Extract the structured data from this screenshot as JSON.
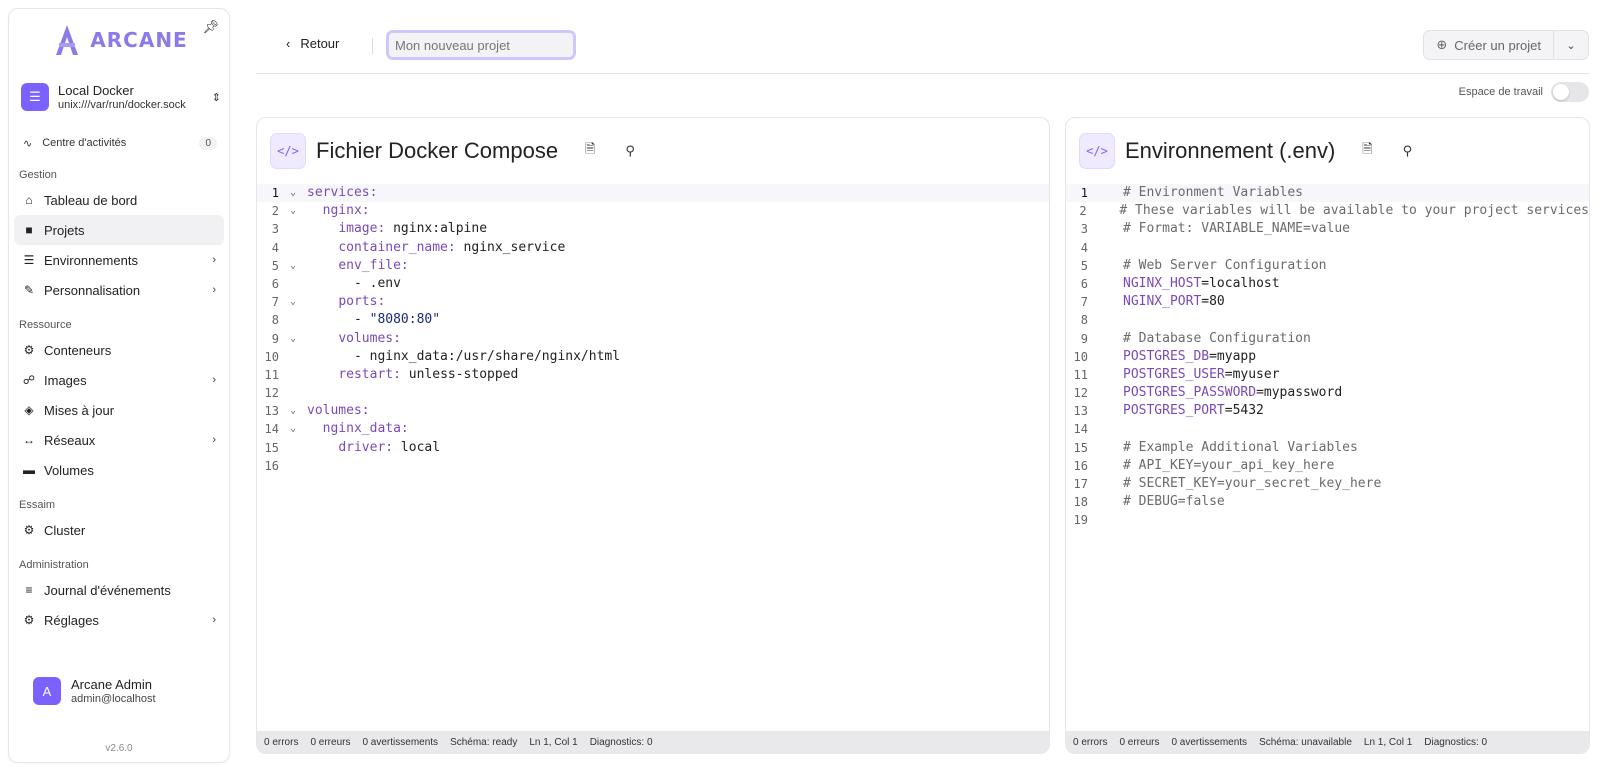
{
  "sidebar": {
    "logo_text": "ARCANE",
    "env_name": "Local Docker",
    "env_socket": "unix:///var/run/docker.sock",
    "activity_label": "Centre d'activités",
    "activity_count": "0",
    "sections": {
      "gestion": "Gestion",
      "ressource": "Ressource",
      "essaim": "Essaim",
      "administration": "Administration"
    },
    "items": {
      "dashboard": "Tableau de bord",
      "projects": "Projets",
      "environments": "Environnements",
      "customization": "Personnalisation",
      "containers": "Conteneurs",
      "images": "Images",
      "updates": "Mises à jour",
      "networks": "Réseaux",
      "volumes": "Volumes",
      "cluster": "Cluster",
      "events": "Journal d'événements",
      "settings": "Réglages"
    },
    "user": {
      "initial": "A",
      "name": "Arcane Admin",
      "email": "admin@localhost"
    },
    "version": "v2.6.0"
  },
  "header": {
    "back_label": "Retour",
    "name_placeholder": "Mon nouveau projet",
    "create_label": "Créer un projet",
    "workspace_label": "Espace de travail"
  },
  "compose_panel": {
    "title": "Fichier Docker Compose",
    "status": {
      "errors": "0 errors",
      "erreurs": "0 erreurs",
      "warnings": "0 avertissements",
      "schema": "Schéma: ready",
      "position": "Ln 1, Col 1",
      "diagnostics": "Diagnostics: 0"
    }
  },
  "env_panel": {
    "title": "Environnement (.env)",
    "status": {
      "errors": "0 errors",
      "erreurs": "0 erreurs",
      "warnings": "0 avertissements",
      "schema": "Schéma: unavailable",
      "position": "Ln 1, Col 1",
      "diagnostics": "Diagnostics: 0"
    }
  },
  "compose_lines": [
    {
      "n": "1",
      "fold": true,
      "parts": [
        [
          "k",
          "services:"
        ]
      ]
    },
    {
      "n": "2",
      "fold": true,
      "parts": [
        [
          "",
          "  "
        ],
        [
          "k",
          "nginx:"
        ]
      ]
    },
    {
      "n": "3",
      "fold": false,
      "parts": [
        [
          "",
          "    "
        ],
        [
          "k",
          "image:"
        ],
        [
          "",
          " nginx:alpine"
        ]
      ]
    },
    {
      "n": "4",
      "fold": false,
      "parts": [
        [
          "",
          "    "
        ],
        [
          "k",
          "container_name:"
        ],
        [
          "",
          " nginx_service"
        ]
      ]
    },
    {
      "n": "5",
      "fold": true,
      "parts": [
        [
          "",
          "    "
        ],
        [
          "k",
          "env_file:"
        ]
      ]
    },
    {
      "n": "6",
      "fold": false,
      "parts": [
        [
          "",
          "      - .env"
        ]
      ]
    },
    {
      "n": "7",
      "fold": true,
      "parts": [
        [
          "",
          "    "
        ],
        [
          "k",
          "ports:"
        ]
      ]
    },
    {
      "n": "8",
      "fold": false,
      "parts": [
        [
          "",
          "      - "
        ],
        [
          "s",
          "\"8080:80\""
        ]
      ]
    },
    {
      "n": "9",
      "fold": true,
      "parts": [
        [
          "",
          "    "
        ],
        [
          "k",
          "volumes:"
        ]
      ]
    },
    {
      "n": "10",
      "fold": false,
      "parts": [
        [
          "",
          "      - nginx_data:/usr/share/nginx/html"
        ]
      ]
    },
    {
      "n": "11",
      "fold": false,
      "parts": [
        [
          "",
          "    "
        ],
        [
          "k",
          "restart:"
        ],
        [
          "",
          " unless-stopped"
        ]
      ]
    },
    {
      "n": "12",
      "fold": false,
      "parts": []
    },
    {
      "n": "13",
      "fold": true,
      "parts": [
        [
          "k",
          "volumes:"
        ]
      ]
    },
    {
      "n": "14",
      "fold": true,
      "parts": [
        [
          "",
          "  "
        ],
        [
          "k",
          "nginx_data:"
        ]
      ]
    },
    {
      "n": "15",
      "fold": false,
      "parts": [
        [
          "",
          "    "
        ],
        [
          "k",
          "driver:"
        ],
        [
          "",
          " local"
        ]
      ]
    },
    {
      "n": "16",
      "fold": false,
      "parts": []
    }
  ],
  "env_lines": [
    {
      "n": "1",
      "parts": [
        [
          "c",
          "# Environment Variables"
        ]
      ]
    },
    {
      "n": "2",
      "parts": [
        [
          "c",
          "# These variables will be available to your project services"
        ]
      ]
    },
    {
      "n": "3",
      "parts": [
        [
          "c",
          "# Format: VARIABLE_NAME=value"
        ]
      ]
    },
    {
      "n": "4",
      "parts": []
    },
    {
      "n": "5",
      "parts": [
        [
          "c",
          "# Web Server Configuration"
        ]
      ]
    },
    {
      "n": "6",
      "parts": [
        [
          "k",
          "NGINX_HOST"
        ],
        [
          "",
          "=localhost"
        ]
      ]
    },
    {
      "n": "7",
      "parts": [
        [
          "k",
          "NGINX_PORT"
        ],
        [
          "",
          "=80"
        ]
      ]
    },
    {
      "n": "8",
      "parts": []
    },
    {
      "n": "9",
      "parts": [
        [
          "c",
          "# Database Configuration"
        ]
      ]
    },
    {
      "n": "10",
      "parts": [
        [
          "k",
          "POSTGRES_DB"
        ],
        [
          "",
          "=myapp"
        ]
      ]
    },
    {
      "n": "11",
      "parts": [
        [
          "k",
          "POSTGRES_USER"
        ],
        [
          "",
          "=myuser"
        ]
      ]
    },
    {
      "n": "12",
      "parts": [
        [
          "k",
          "POSTGRES_PASSWORD"
        ],
        [
          "",
          "=mypassword"
        ]
      ]
    },
    {
      "n": "13",
      "parts": [
        [
          "k",
          "POSTGRES_PORT"
        ],
        [
          "",
          "=5432"
        ]
      ]
    },
    {
      "n": "14",
      "parts": []
    },
    {
      "n": "15",
      "parts": [
        [
          "c",
          "# Example Additional Variables"
        ]
      ]
    },
    {
      "n": "16",
      "parts": [
        [
          "c",
          "# API_KEY=your_api_key_here"
        ]
      ]
    },
    {
      "n": "17",
      "parts": [
        [
          "c",
          "# SECRET_KEY=your_secret_key_here"
        ]
      ]
    },
    {
      "n": "18",
      "parts": [
        [
          "c",
          "# DEBUG=false"
        ]
      ]
    },
    {
      "n": "19",
      "parts": []
    }
  ]
}
